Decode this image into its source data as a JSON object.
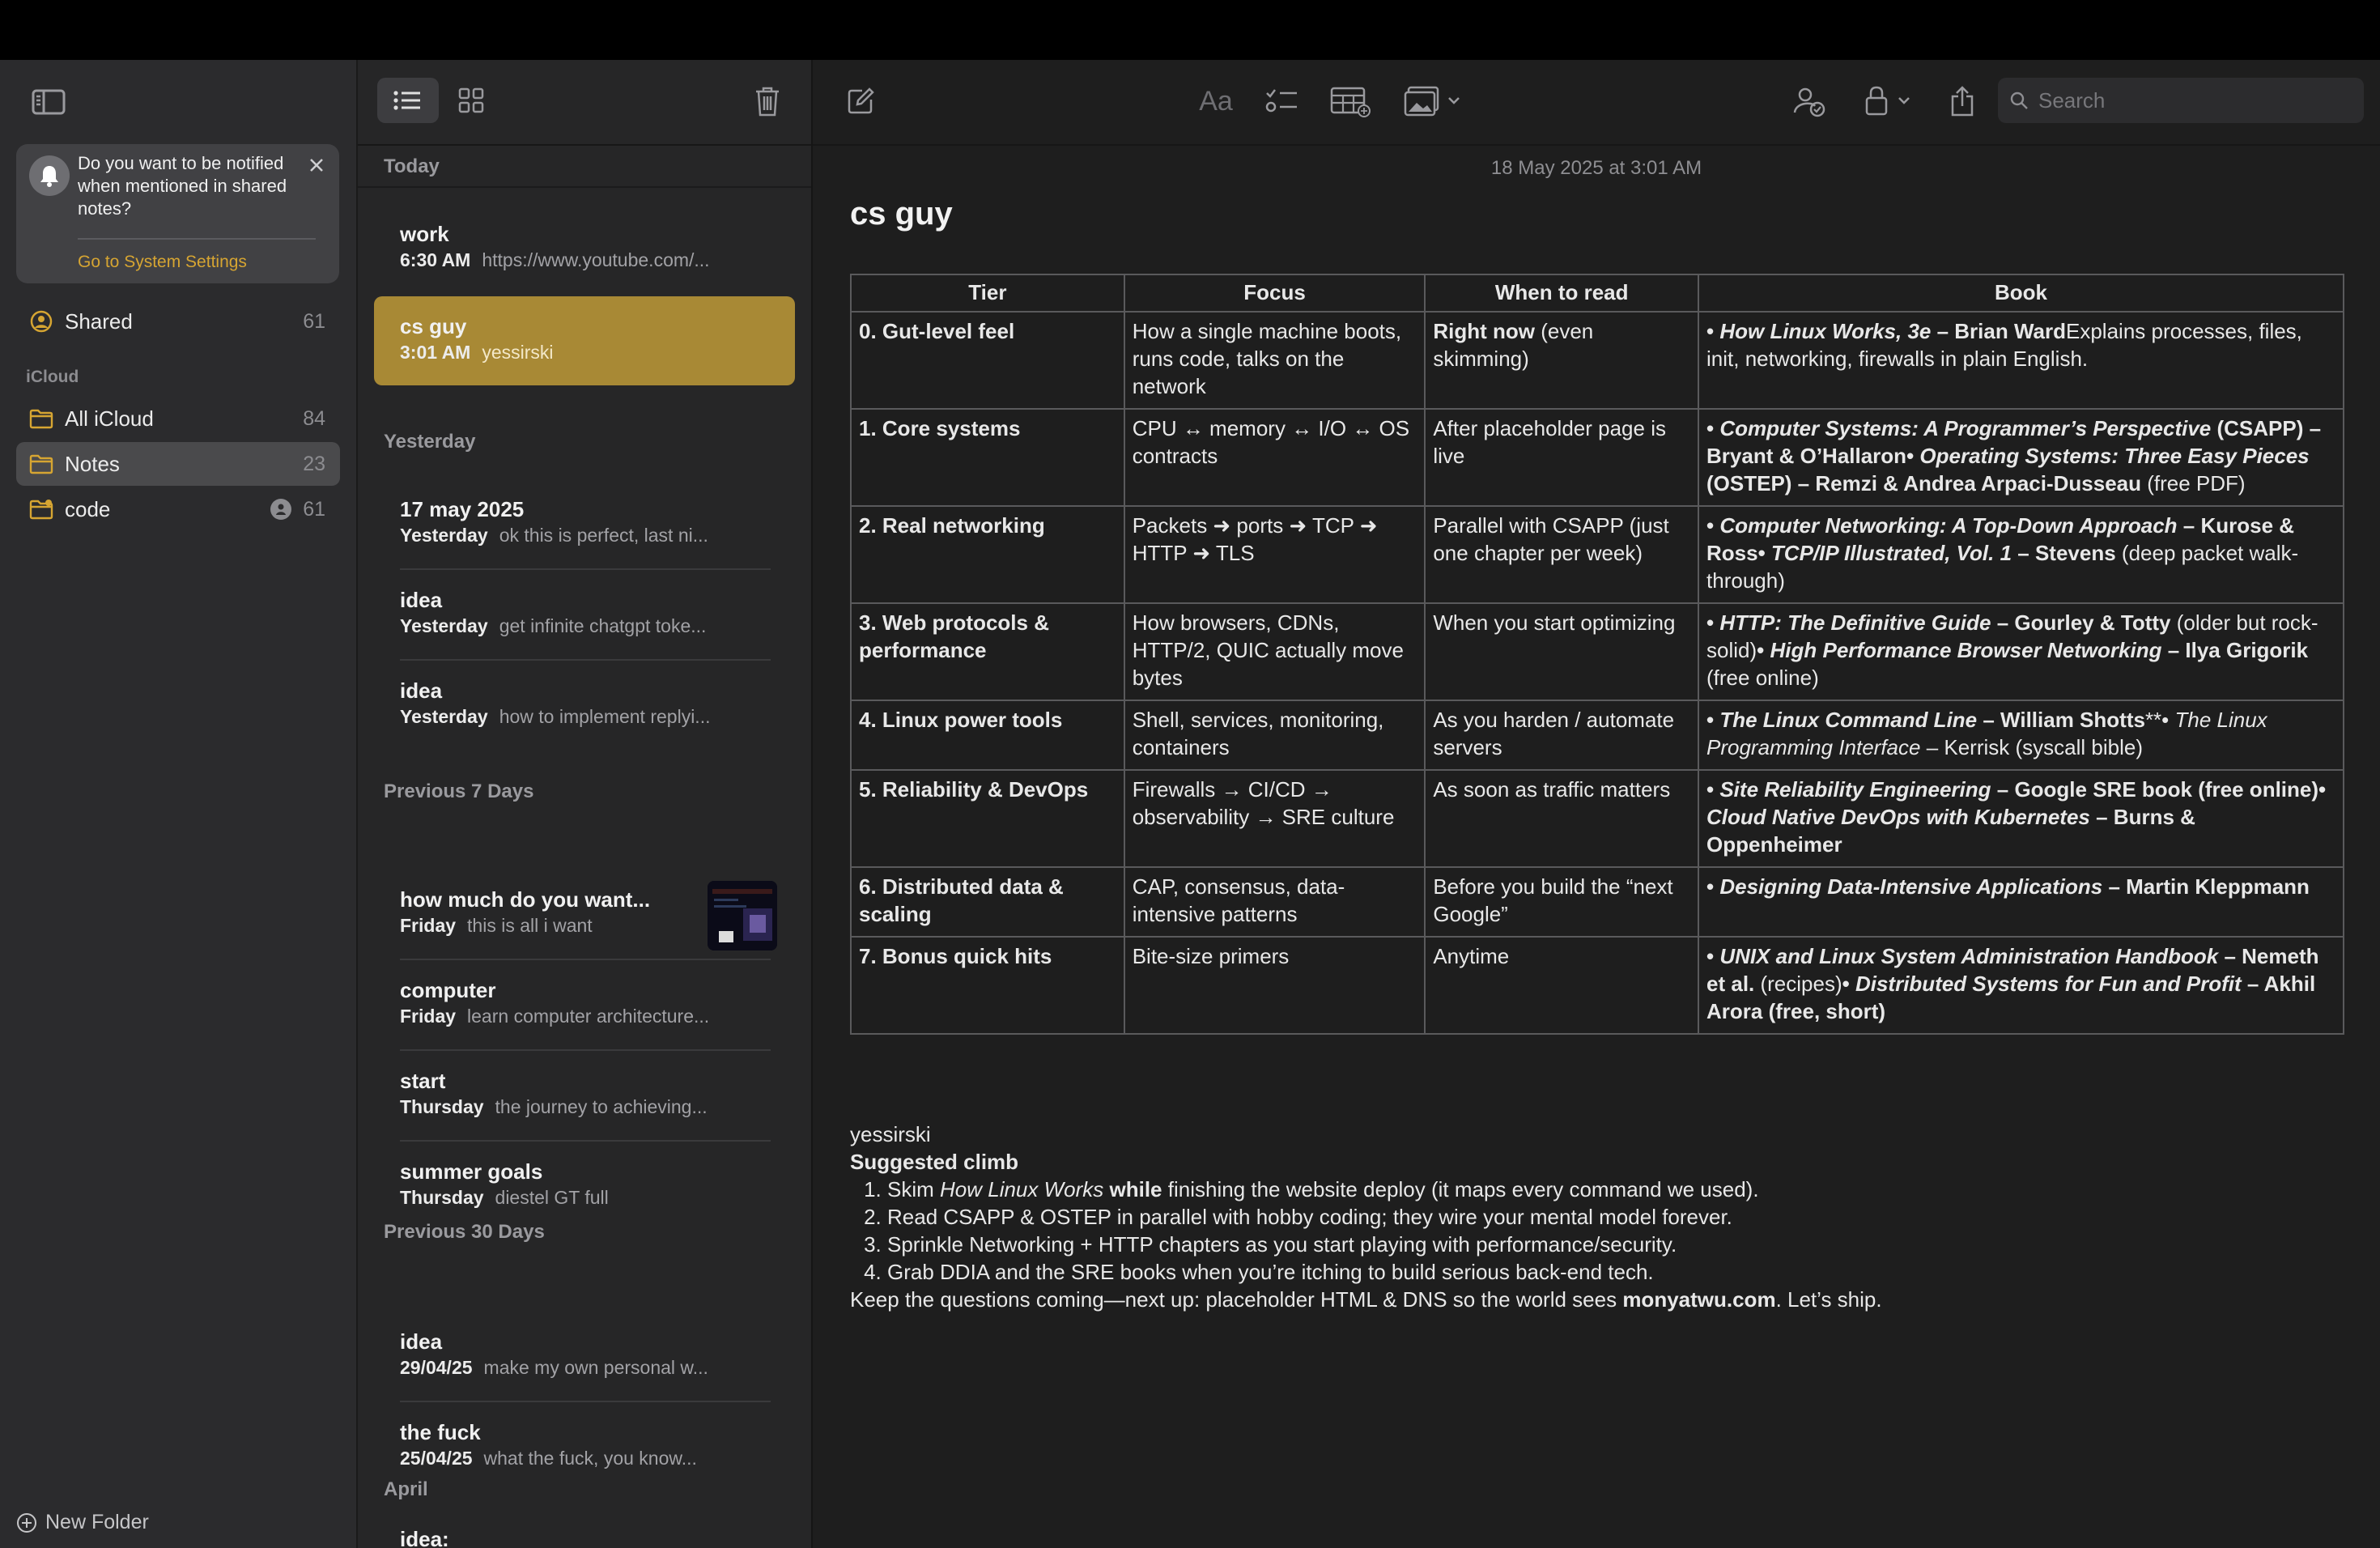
{
  "sidebar": {
    "notification": {
      "message": "Do you want to be notified when mentioned in shared notes?",
      "link": "Go to System Settings"
    },
    "shared": {
      "label": "Shared",
      "count": "61"
    },
    "section_label": "iCloud",
    "folders": [
      {
        "label": "All iCloud",
        "count": "84"
      },
      {
        "label": "Notes",
        "count": "23"
      },
      {
        "label": "code",
        "count": "61"
      }
    ],
    "new_folder": "New Folder",
    "accent_color": "#d6a532"
  },
  "note_list": {
    "groups": [
      {
        "label": "Today"
      },
      {
        "label": "Yesterday"
      },
      {
        "label": "Previous 7 Days"
      },
      {
        "label": "Previous 30 Days"
      },
      {
        "label": "April"
      }
    ],
    "notes": [
      {
        "title": "work",
        "date": "6:30 AM",
        "preview": "https://www.youtube.com/..."
      },
      {
        "title": "cs guy",
        "date": "3:01 AM",
        "preview": "yessirski"
      },
      {
        "title": "17 may 2025",
        "date": "Yesterday",
        "preview": "ok this is perfect, last ni..."
      },
      {
        "title": "idea",
        "date": "Yesterday",
        "preview": "get infinite chatgpt toke..."
      },
      {
        "title": "idea",
        "date": "Yesterday",
        "preview": "how to implement replyi..."
      },
      {
        "title": "how much do you want...",
        "date": "Friday",
        "preview": "this is all i want"
      },
      {
        "title": "computer",
        "date": "Friday",
        "preview": "learn computer architecture..."
      },
      {
        "title": "start",
        "date": "Thursday",
        "preview": "the journey to achieving..."
      },
      {
        "title": "summer goals",
        "date": "Thursday",
        "preview": "diestel GT full"
      },
      {
        "title": "idea",
        "date": "29/04/25",
        "preview": "make my own personal w..."
      },
      {
        "title": "the fuck",
        "date": "25/04/25",
        "preview": "what the fuck, you know..."
      },
      {
        "title": "idea:",
        "date": "",
        "preview": ""
      }
    ],
    "selected_color": "#a88935"
  },
  "editor": {
    "search_placeholder": "Search",
    "format_label": "Aa",
    "date": "18 May 2025 at 3:01 AM",
    "title": "cs guy",
    "table": {
      "headers": [
        "Tier",
        "Focus",
        "When to read",
        "Book"
      ],
      "rows": [
        {
          "tier": "0. Gut-level feel",
          "focus": "How a single machine boots, runs code, talks on the network",
          "when_bold": "Right now",
          "when_rest": " (even skimming)",
          "book": [
            {
              "t": "• ",
              "b": true
            },
            {
              "t": "How Linux Works, 3e",
              "b": true,
              "i": true
            },
            {
              "t": " – Brian Ward",
              "b": true
            },
            {
              "t": "Explains processes, files, init, networking, firewalls in plain English."
            }
          ]
        },
        {
          "tier": "1. Core systems",
          "focus": "CPU ↔ memory ↔ I/O ↔ OS contracts",
          "when_bold": "",
          "when_rest": "After placeholder page is live",
          "book": [
            {
              "t": "• ",
              "b": true
            },
            {
              "t": "Computer Systems: A Programmer’s Perspective",
              "b": true,
              "i": true
            },
            {
              "t": " (CSAPP) – Bryant & O’Hallaron",
              "b": true
            },
            {
              "t": "• ",
              "b": true
            },
            {
              "t": "Operating Systems: Three Easy Pieces",
              "b": true,
              "i": true
            },
            {
              "t": " (OSTEP) – Remzi & Andrea Arpaci-Dusseau",
              "b": true
            },
            {
              "t": " (free PDF)"
            }
          ]
        },
        {
          "tier": "2. Real networking",
          "focus": "Packets ➜ ports ➜ TCP ➜ HTTP ➜ TLS",
          "when_bold": "",
          "when_rest": "Parallel with CSAPP (just one chapter per week)",
          "book": [
            {
              "t": "• ",
              "b": true
            },
            {
              "t": "Computer Networking: A Top-Down Approach",
              "b": true,
              "i": true
            },
            {
              "t": " – Kurose & Ross",
              "b": true
            },
            {
              "t": "• ",
              "b": true
            },
            {
              "t": "TCP/IP Illustrated, Vol. 1",
              "b": true,
              "i": true
            },
            {
              "t": " – Stevens",
              "b": true
            },
            {
              "t": " (deep packet walk-through)"
            }
          ]
        },
        {
          "tier": "3. Web protocols & performance",
          "focus": "How browsers, CDNs, HTTP/2, QUIC actually move bytes",
          "when_bold": "",
          "when_rest": "When you start optimizing",
          "book": [
            {
              "t": "• ",
              "b": true
            },
            {
              "t": "HTTP: The Definitive Guide",
              "b": true,
              "i": true
            },
            {
              "t": " – Gourley & Totty",
              "b": true
            },
            {
              "t": " (older but rock-solid)"
            },
            {
              "t": "• ",
              "b": true
            },
            {
              "t": "High Performance Browser Networking",
              "b": true,
              "i": true
            },
            {
              "t": " – Ilya Grigorik",
              "b": true
            },
            {
              "t": " (free online)"
            }
          ]
        },
        {
          "tier": "4. Linux power tools",
          "focus": "Shell, services, monitoring, containers",
          "when_bold": "",
          "when_rest": "As you harden / automate servers",
          "book": [
            {
              "t": "• ",
              "b": true
            },
            {
              "t": "The Linux Command Line",
              "b": true,
              "i": true
            },
            {
              "t": " – William Shotts",
              "b": true
            },
            {
              "t": "**• "
            },
            {
              "t": "The Linux Programming Interface",
              "i": true
            },
            {
              "t": " – Kerrisk (syscall bible)"
            }
          ]
        },
        {
          "tier": "5. Reliability & DevOps",
          "focus": "Firewalls → CI/CD → observability → SRE culture",
          "when_bold": "",
          "when_rest": "As soon as traffic matters",
          "book": [
            {
              "t": "• ",
              "b": true
            },
            {
              "t": "Site Reliability Engineering",
              "b": true,
              "i": true
            },
            {
              "t": " – Google SRE book (free online)",
              "b": true
            },
            {
              "t": "• ",
              "b": true
            },
            {
              "t": "Cloud Native DevOps with Kubernetes",
              "b": true,
              "i": true
            },
            {
              "t": " – Burns & Oppenheimer",
              "b": true
            }
          ]
        },
        {
          "tier": "6. Distributed data & scaling",
          "focus": "CAP, consensus, data-intensive patterns",
          "when_bold": "",
          "when_rest": "Before you build the “next Google”",
          "book": [
            {
              "t": "• ",
              "b": true
            },
            {
              "t": "Designing Data-Intensive Applications",
              "b": true,
              "i": true
            },
            {
              "t": " – Martin Kleppmann",
              "b": true
            }
          ]
        },
        {
          "tier": "7. Bonus quick hits",
          "focus": "Bite-size primers",
          "when_bold": "",
          "when_rest": "Anytime",
          "book": [
            {
              "t": "• ",
              "b": true
            },
            {
              "t": "UNIX and Linux System Administration Handbook",
              "b": true,
              "i": true
            },
            {
              "t": " – Nemeth et al.",
              "b": true
            },
            {
              "t": " (recipes)"
            },
            {
              "t": "• ",
              "b": true
            },
            {
              "t": "Distributed Systems for Fun and Profit",
              "b": true,
              "i": true
            },
            {
              "t": " – Akhil Arora (free, short)",
              "b": true
            }
          ]
        }
      ]
    },
    "after_table": "yessirski",
    "climb_heading": "Suggested climb",
    "steps": [
      [
        {
          "t": "Skim "
        },
        {
          "t": "How Linux Works",
          "i": true
        },
        {
          "t": " while",
          "b": true
        },
        {
          "t": " finishing the website deploy (it maps every command we used)."
        }
      ],
      [
        {
          "t": "Read CSAPP & OSTEP in parallel with hobby coding; they wire your mental model forever."
        }
      ],
      [
        {
          "t": "Sprinkle Networking + HTTP chapters as you start playing with performance/security."
        }
      ],
      [
        {
          "t": "Grab DDIA and the SRE books when you’re itching to build serious back-end tech."
        }
      ]
    ],
    "closing": [
      {
        "t": "Keep the questions coming—next up: placeholder HTML & DNS so the world sees "
      },
      {
        "t": "monyatwu.com",
        "b": true
      },
      {
        "t": ". Let’s ship."
      }
    ]
  }
}
